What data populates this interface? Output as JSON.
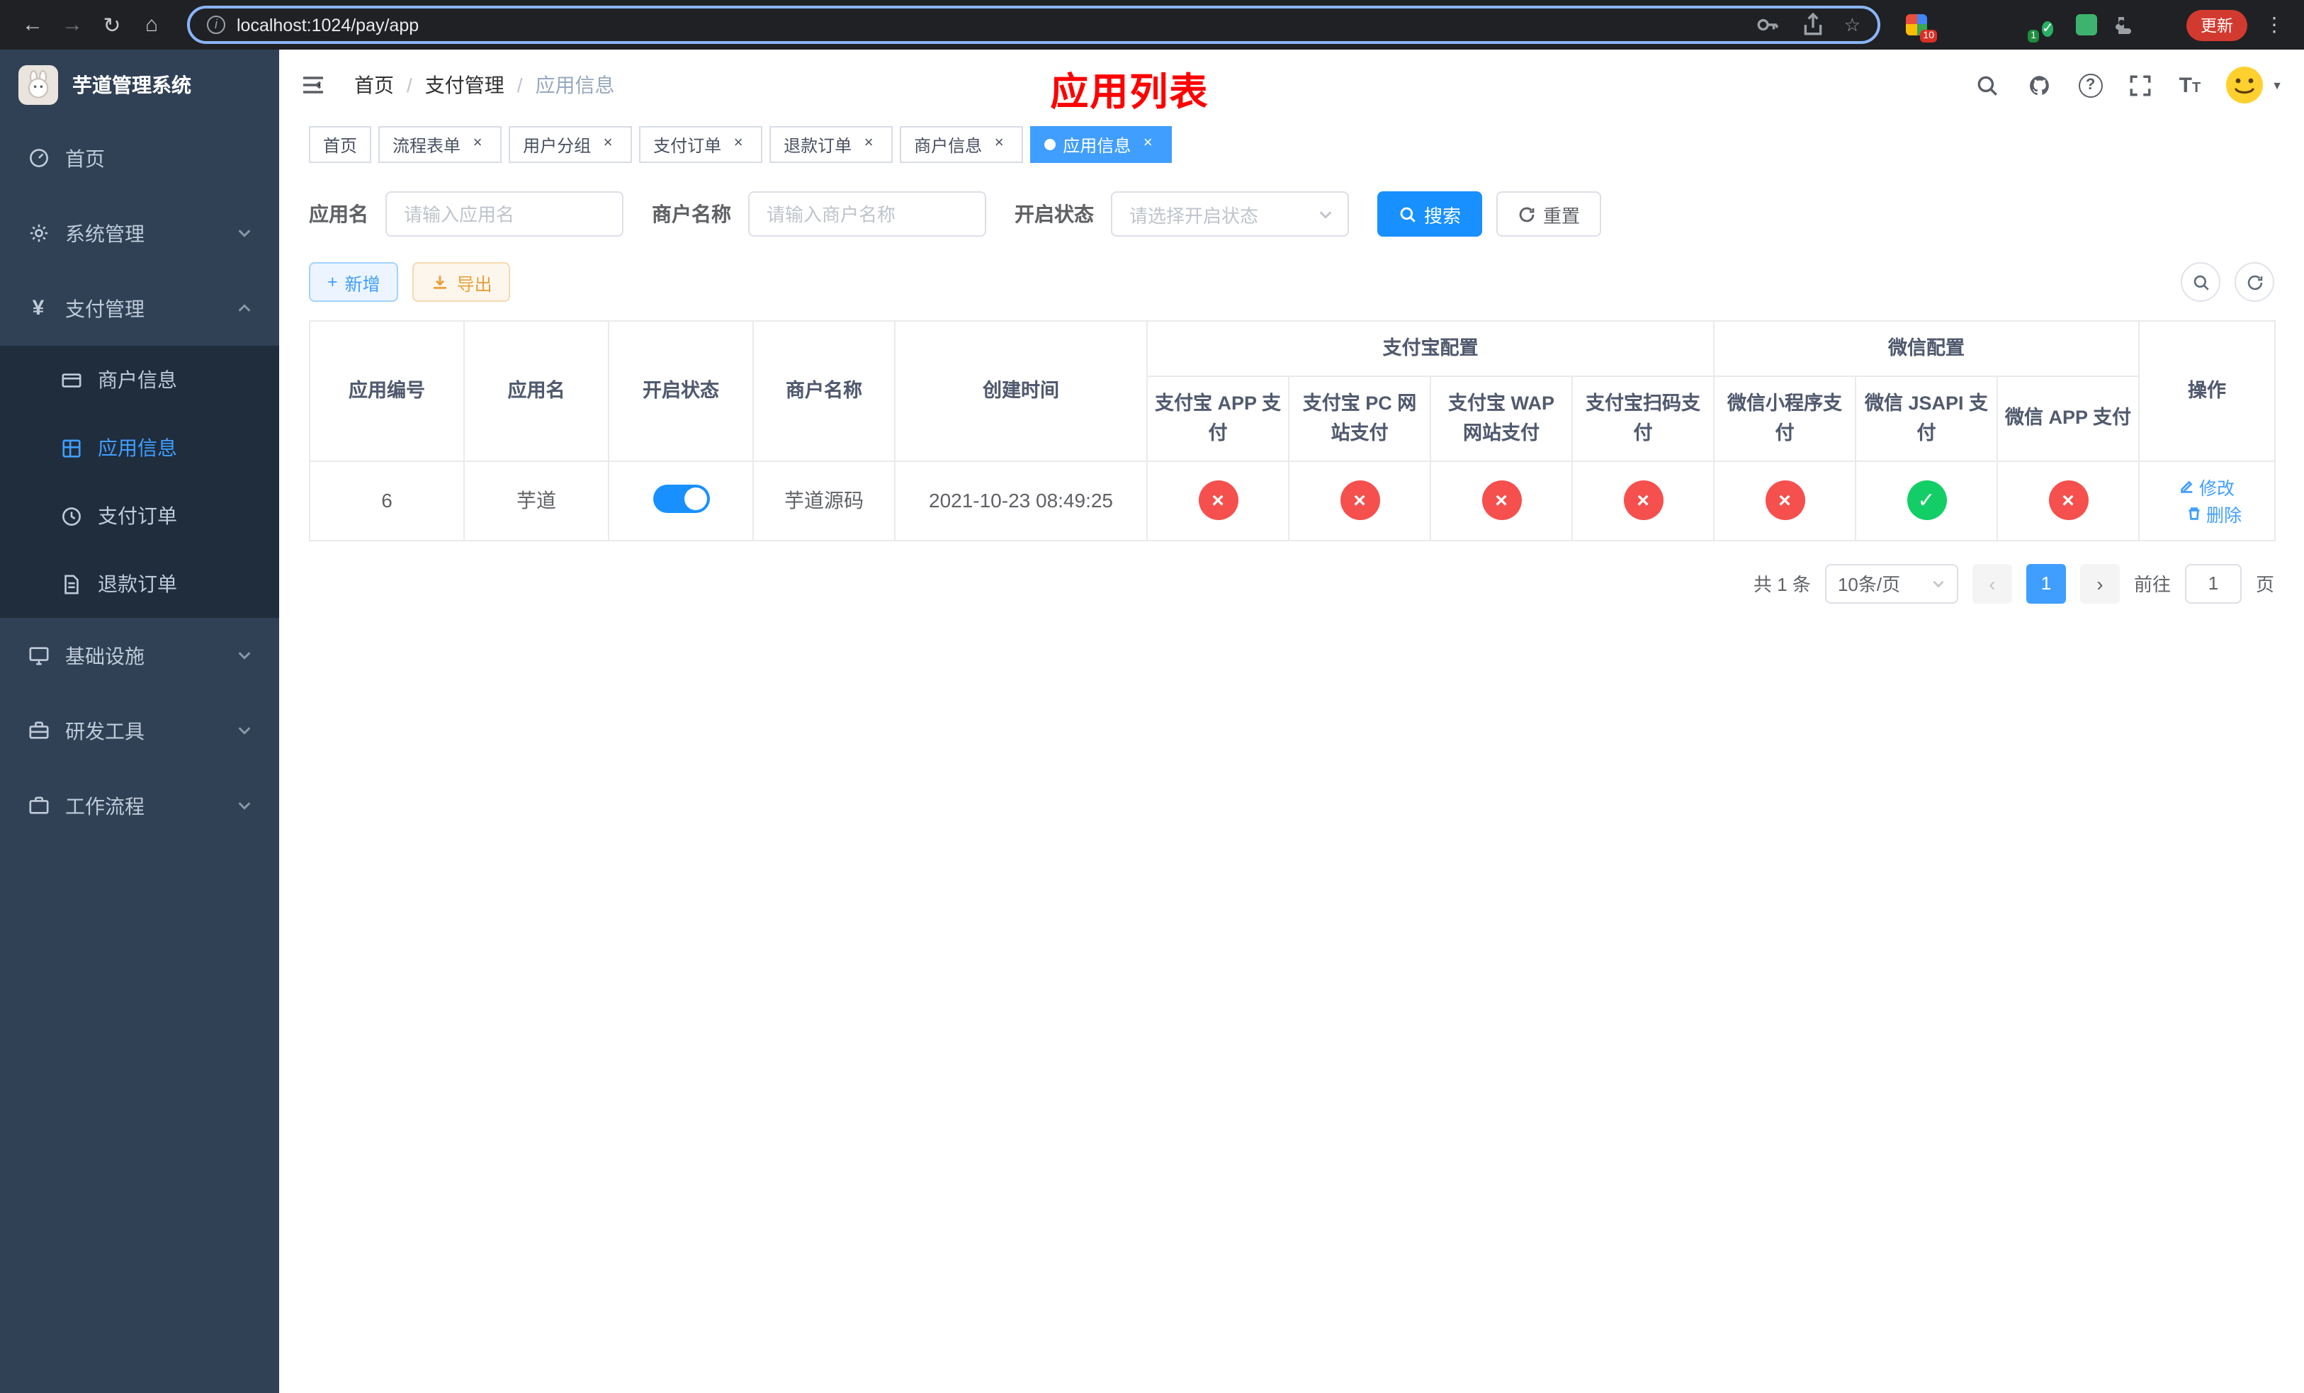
{
  "colors": {
    "accent": "#409eff",
    "search-blue": "#1890ff",
    "danger": "#f5504e",
    "success": "#13ce66",
    "warning": "#e6a23c",
    "sidebar-bg": "#304156",
    "submenu-bg": "#1f2d3d",
    "annotation-red": "#ff0000"
  },
  "icons": {
    "back": "←",
    "forward": "→",
    "reload": "↻",
    "home": "⌂",
    "more": "⋮",
    "star": "☆",
    "close": "×",
    "prev": "‹",
    "next": "›",
    "plus": "+",
    "slash": "/",
    "yen": "¥",
    "question": "?"
  },
  "browser": {
    "url": "localhost:1024/pay/app",
    "update_label": "更新",
    "ext_badge_1": "10",
    "ext_badge_2": "1"
  },
  "sidebar": {
    "title": "芋道管理系统",
    "items": [
      {
        "label": "首页"
      },
      {
        "label": "系统管理"
      },
      {
        "label": "支付管理"
      },
      {
        "label": "基础设施"
      },
      {
        "label": "研发工具"
      },
      {
        "label": "工作流程"
      }
    ],
    "submenu": [
      {
        "label": "商户信息"
      },
      {
        "label": "应用信息"
      },
      {
        "label": "支付订单"
      },
      {
        "label": "退款订单"
      }
    ]
  },
  "header": {
    "breadcrumb": [
      "首页",
      "支付管理",
      "应用信息"
    ],
    "overlay_title": "应用列表"
  },
  "tabs": [
    {
      "label": "首页"
    },
    {
      "label": "流程表单"
    },
    {
      "label": "用户分组"
    },
    {
      "label": "支付订单"
    },
    {
      "label": "退款订单"
    },
    {
      "label": "商户信息"
    },
    {
      "label": "应用信息"
    }
  ],
  "filters": {
    "app_name_label": "应用名",
    "app_name_placeholder": "请输入应用名",
    "merchant_label": "商户名称",
    "merchant_placeholder": "请输入商户名称",
    "status_label": "开启状态",
    "status_placeholder": "请选择开启状态",
    "search_label": "搜索",
    "reset_label": "重置"
  },
  "toolbar": {
    "add_label": "新增",
    "export_label": "导出"
  },
  "table": {
    "groups": {
      "alipay": "支付宝配置",
      "wechat": "微信配置"
    },
    "columns": [
      "应用编号",
      "应用名",
      "开启状态",
      "商户名称",
      "创建时间",
      "支付宝 APP 支付",
      "支付宝 PC 网站支付",
      "支付宝 WAP 网站支付",
      "支付宝扫码支付",
      "微信小程序支付",
      "微信 JSAPI 支付",
      "微信 APP 支付",
      "操作"
    ],
    "row": {
      "id": "6",
      "name": "芋道",
      "status_on": "true",
      "merchant": "芋道源码",
      "created": "2021-10-23 08:49:25",
      "configs": [
        "fail",
        "fail",
        "fail",
        "fail",
        "fail",
        "success",
        "fail"
      ],
      "edit_label": "修改",
      "delete_label": "删除"
    }
  },
  "pagination": {
    "total": "共 1 条",
    "page_size": "10条/页",
    "page": "1",
    "goto": "前往",
    "goto_value": "1",
    "unit": "页"
  }
}
